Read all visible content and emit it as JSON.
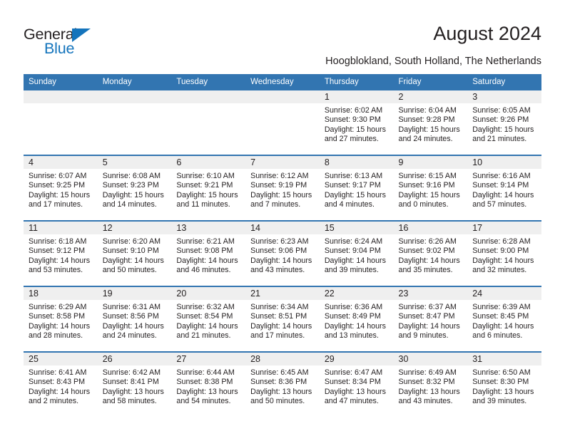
{
  "brand": {
    "name_part1": "General",
    "name_part2": "Blue",
    "accent_color": "#1474bc",
    "logo_icon": "triangle-flag-icon"
  },
  "header": {
    "title": "August 2024",
    "subtitle": "Hoogblokland, South Holland, The Netherlands"
  },
  "theme": {
    "header_bar_color": "#3275b1",
    "day_strip_color": "#efefef",
    "week_separator_color": "#3275b1",
    "text_color": "#231f20"
  },
  "columns": [
    "Sunday",
    "Monday",
    "Tuesday",
    "Wednesday",
    "Thursday",
    "Friday",
    "Saturday"
  ],
  "weeks": [
    [
      {
        "day": "",
        "empty": true,
        "sunrise": "",
        "sunset": "",
        "daylight_line1": "",
        "daylight_line2": ""
      },
      {
        "day": "",
        "empty": true,
        "sunrise": "",
        "sunset": "",
        "daylight_line1": "",
        "daylight_line2": ""
      },
      {
        "day": "",
        "empty": true,
        "sunrise": "",
        "sunset": "",
        "daylight_line1": "",
        "daylight_line2": ""
      },
      {
        "day": "",
        "empty": true,
        "sunrise": "",
        "sunset": "",
        "daylight_line1": "",
        "daylight_line2": ""
      },
      {
        "day": "1",
        "empty": false,
        "sunrise": "Sunrise: 6:02 AM",
        "sunset": "Sunset: 9:30 PM",
        "daylight_line1": "Daylight: 15 hours",
        "daylight_line2": "and 27 minutes."
      },
      {
        "day": "2",
        "empty": false,
        "sunrise": "Sunrise: 6:04 AM",
        "sunset": "Sunset: 9:28 PM",
        "daylight_line1": "Daylight: 15 hours",
        "daylight_line2": "and 24 minutes."
      },
      {
        "day": "3",
        "empty": false,
        "sunrise": "Sunrise: 6:05 AM",
        "sunset": "Sunset: 9:26 PM",
        "daylight_line1": "Daylight: 15 hours",
        "daylight_line2": "and 21 minutes."
      }
    ],
    [
      {
        "day": "4",
        "empty": false,
        "sunrise": "Sunrise: 6:07 AM",
        "sunset": "Sunset: 9:25 PM",
        "daylight_line1": "Daylight: 15 hours",
        "daylight_line2": "and 17 minutes."
      },
      {
        "day": "5",
        "empty": false,
        "sunrise": "Sunrise: 6:08 AM",
        "sunset": "Sunset: 9:23 PM",
        "daylight_line1": "Daylight: 15 hours",
        "daylight_line2": "and 14 minutes."
      },
      {
        "day": "6",
        "empty": false,
        "sunrise": "Sunrise: 6:10 AM",
        "sunset": "Sunset: 9:21 PM",
        "daylight_line1": "Daylight: 15 hours",
        "daylight_line2": "and 11 minutes."
      },
      {
        "day": "7",
        "empty": false,
        "sunrise": "Sunrise: 6:12 AM",
        "sunset": "Sunset: 9:19 PM",
        "daylight_line1": "Daylight: 15 hours",
        "daylight_line2": "and 7 minutes."
      },
      {
        "day": "8",
        "empty": false,
        "sunrise": "Sunrise: 6:13 AM",
        "sunset": "Sunset: 9:17 PM",
        "daylight_line1": "Daylight: 15 hours",
        "daylight_line2": "and 4 minutes."
      },
      {
        "day": "9",
        "empty": false,
        "sunrise": "Sunrise: 6:15 AM",
        "sunset": "Sunset: 9:16 PM",
        "daylight_line1": "Daylight: 15 hours",
        "daylight_line2": "and 0 minutes."
      },
      {
        "day": "10",
        "empty": false,
        "sunrise": "Sunrise: 6:16 AM",
        "sunset": "Sunset: 9:14 PM",
        "daylight_line1": "Daylight: 14 hours",
        "daylight_line2": "and 57 minutes."
      }
    ],
    [
      {
        "day": "11",
        "empty": false,
        "sunrise": "Sunrise: 6:18 AM",
        "sunset": "Sunset: 9:12 PM",
        "daylight_line1": "Daylight: 14 hours",
        "daylight_line2": "and 53 minutes."
      },
      {
        "day": "12",
        "empty": false,
        "sunrise": "Sunrise: 6:20 AM",
        "sunset": "Sunset: 9:10 PM",
        "daylight_line1": "Daylight: 14 hours",
        "daylight_line2": "and 50 minutes."
      },
      {
        "day": "13",
        "empty": false,
        "sunrise": "Sunrise: 6:21 AM",
        "sunset": "Sunset: 9:08 PM",
        "daylight_line1": "Daylight: 14 hours",
        "daylight_line2": "and 46 minutes."
      },
      {
        "day": "14",
        "empty": false,
        "sunrise": "Sunrise: 6:23 AM",
        "sunset": "Sunset: 9:06 PM",
        "daylight_line1": "Daylight: 14 hours",
        "daylight_line2": "and 43 minutes."
      },
      {
        "day": "15",
        "empty": false,
        "sunrise": "Sunrise: 6:24 AM",
        "sunset": "Sunset: 9:04 PM",
        "daylight_line1": "Daylight: 14 hours",
        "daylight_line2": "and 39 minutes."
      },
      {
        "day": "16",
        "empty": false,
        "sunrise": "Sunrise: 6:26 AM",
        "sunset": "Sunset: 9:02 PM",
        "daylight_line1": "Daylight: 14 hours",
        "daylight_line2": "and 35 minutes."
      },
      {
        "day": "17",
        "empty": false,
        "sunrise": "Sunrise: 6:28 AM",
        "sunset": "Sunset: 9:00 PM",
        "daylight_line1": "Daylight: 14 hours",
        "daylight_line2": "and 32 minutes."
      }
    ],
    [
      {
        "day": "18",
        "empty": false,
        "sunrise": "Sunrise: 6:29 AM",
        "sunset": "Sunset: 8:58 PM",
        "daylight_line1": "Daylight: 14 hours",
        "daylight_line2": "and 28 minutes."
      },
      {
        "day": "19",
        "empty": false,
        "sunrise": "Sunrise: 6:31 AM",
        "sunset": "Sunset: 8:56 PM",
        "daylight_line1": "Daylight: 14 hours",
        "daylight_line2": "and 24 minutes."
      },
      {
        "day": "20",
        "empty": false,
        "sunrise": "Sunrise: 6:32 AM",
        "sunset": "Sunset: 8:54 PM",
        "daylight_line1": "Daylight: 14 hours",
        "daylight_line2": "and 21 minutes."
      },
      {
        "day": "21",
        "empty": false,
        "sunrise": "Sunrise: 6:34 AM",
        "sunset": "Sunset: 8:51 PM",
        "daylight_line1": "Daylight: 14 hours",
        "daylight_line2": "and 17 minutes."
      },
      {
        "day": "22",
        "empty": false,
        "sunrise": "Sunrise: 6:36 AM",
        "sunset": "Sunset: 8:49 PM",
        "daylight_line1": "Daylight: 14 hours",
        "daylight_line2": "and 13 minutes."
      },
      {
        "day": "23",
        "empty": false,
        "sunrise": "Sunrise: 6:37 AM",
        "sunset": "Sunset: 8:47 PM",
        "daylight_line1": "Daylight: 14 hours",
        "daylight_line2": "and 9 minutes."
      },
      {
        "day": "24",
        "empty": false,
        "sunrise": "Sunrise: 6:39 AM",
        "sunset": "Sunset: 8:45 PM",
        "daylight_line1": "Daylight: 14 hours",
        "daylight_line2": "and 6 minutes."
      }
    ],
    [
      {
        "day": "25",
        "empty": false,
        "sunrise": "Sunrise: 6:41 AM",
        "sunset": "Sunset: 8:43 PM",
        "daylight_line1": "Daylight: 14 hours",
        "daylight_line2": "and 2 minutes."
      },
      {
        "day": "26",
        "empty": false,
        "sunrise": "Sunrise: 6:42 AM",
        "sunset": "Sunset: 8:41 PM",
        "daylight_line1": "Daylight: 13 hours",
        "daylight_line2": "and 58 minutes."
      },
      {
        "day": "27",
        "empty": false,
        "sunrise": "Sunrise: 6:44 AM",
        "sunset": "Sunset: 8:38 PM",
        "daylight_line1": "Daylight: 13 hours",
        "daylight_line2": "and 54 minutes."
      },
      {
        "day": "28",
        "empty": false,
        "sunrise": "Sunrise: 6:45 AM",
        "sunset": "Sunset: 8:36 PM",
        "daylight_line1": "Daylight: 13 hours",
        "daylight_line2": "and 50 minutes."
      },
      {
        "day": "29",
        "empty": false,
        "sunrise": "Sunrise: 6:47 AM",
        "sunset": "Sunset: 8:34 PM",
        "daylight_line1": "Daylight: 13 hours",
        "daylight_line2": "and 47 minutes."
      },
      {
        "day": "30",
        "empty": false,
        "sunrise": "Sunrise: 6:49 AM",
        "sunset": "Sunset: 8:32 PM",
        "daylight_line1": "Daylight: 13 hours",
        "daylight_line2": "and 43 minutes."
      },
      {
        "day": "31",
        "empty": false,
        "sunrise": "Sunrise: 6:50 AM",
        "sunset": "Sunset: 8:30 PM",
        "daylight_line1": "Daylight: 13 hours",
        "daylight_line2": "and 39 minutes."
      }
    ]
  ]
}
